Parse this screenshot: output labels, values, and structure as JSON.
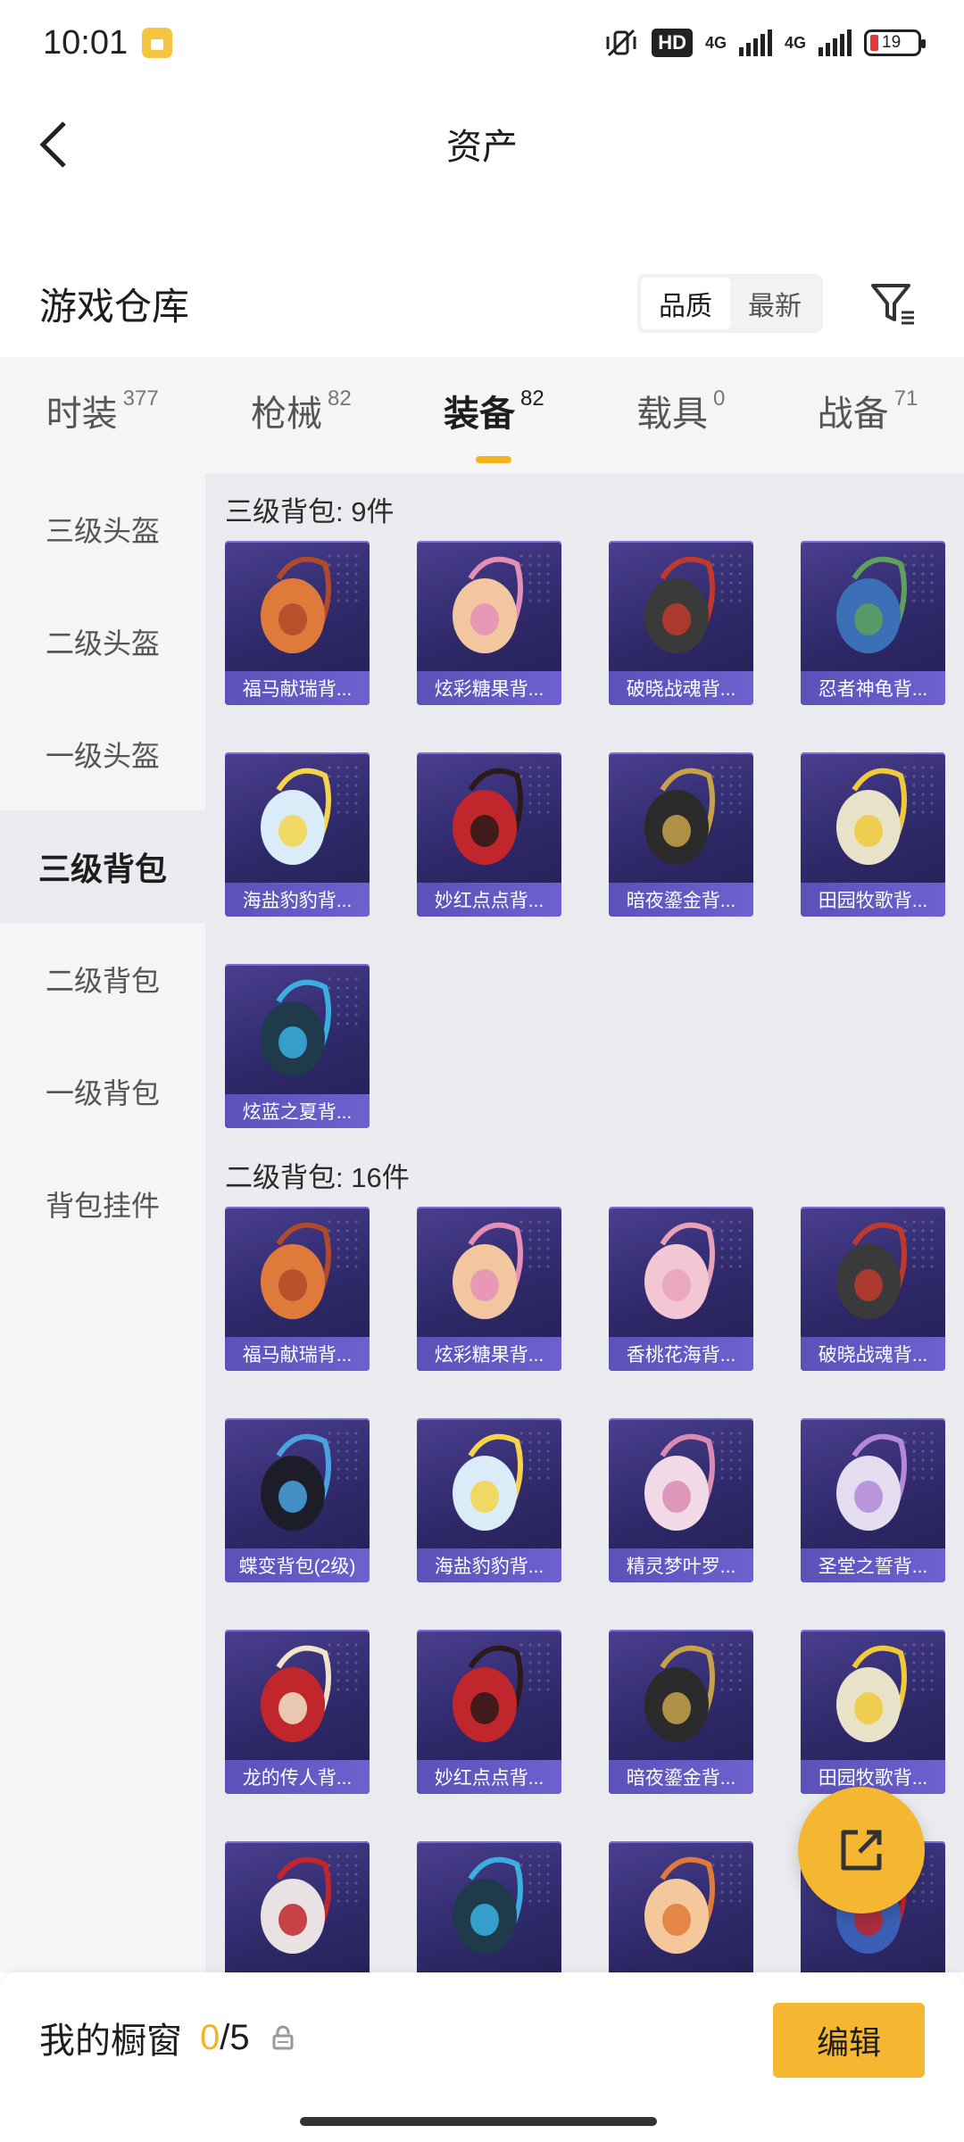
{
  "status_bar": {
    "time": "10:01",
    "hd": "HD",
    "net1": "4G",
    "net2": "4G",
    "battery": "19"
  },
  "header": {
    "title": "资产"
  },
  "warehouse": {
    "title": "游戏仓库",
    "sort_quality": "品质",
    "sort_newest": "最新"
  },
  "tabs": [
    {
      "label": "时装",
      "count": "377"
    },
    {
      "label": "枪械",
      "count": "82"
    },
    {
      "label": "装备",
      "count": "82"
    },
    {
      "label": "载具",
      "count": "0"
    },
    {
      "label": "战备",
      "count": "71"
    }
  ],
  "sidebar": {
    "items": [
      {
        "label": "三级头盔"
      },
      {
        "label": "二级头盔"
      },
      {
        "label": "一级头盔"
      },
      {
        "label": "三级背包"
      },
      {
        "label": "二级背包"
      },
      {
        "label": "一级背包"
      },
      {
        "label": "背包挂件"
      }
    ]
  },
  "sections": [
    {
      "title": "三级背包: 9件",
      "items": [
        {
          "name": "福马献瑞背...",
          "icon": "rabbit-backpack"
        },
        {
          "name": "炫彩糖果背...",
          "icon": "donut-backpack"
        },
        {
          "name": "破晓战魂背...",
          "icon": "armor-backpack"
        },
        {
          "name": "忍者神龟背...",
          "icon": "turtle-backpack"
        },
        {
          "name": "海盐豹豹背...",
          "icon": "seal-backpack"
        },
        {
          "name": "妙红点点背...",
          "icon": "ladybug-backpack"
        },
        {
          "name": "暗夜鎏金背...",
          "icon": "dark-gold-backpack"
        },
        {
          "name": "田园牧歌背...",
          "icon": "basket-backpack"
        },
        {
          "name": "炫蓝之夏背...",
          "icon": "blue-backpack"
        }
      ]
    },
    {
      "title": "二级背包: 16件",
      "items": [
        {
          "name": "福马献瑞背...",
          "icon": "rabbit-backpack"
        },
        {
          "name": "炫彩糖果背...",
          "icon": "donut-backpack"
        },
        {
          "name": "香桃花海背...",
          "icon": "pink-backpack"
        },
        {
          "name": "破晓战魂背...",
          "icon": "armor-backpack"
        },
        {
          "name": "蝶变背包(2级)",
          "icon": "butterfly-backpack"
        },
        {
          "name": "海盐豹豹背...",
          "icon": "seal-backpack"
        },
        {
          "name": "精灵梦叶罗...",
          "icon": "heart-backpack"
        },
        {
          "name": "圣堂之誓背...",
          "icon": "wing-backpack"
        },
        {
          "name": "龙的传人背...",
          "icon": "red-backpack"
        },
        {
          "name": "妙红点点背...",
          "icon": "ladybug-backpack"
        },
        {
          "name": "暗夜鎏金背...",
          "icon": "dark-gold-backpack"
        },
        {
          "name": "田园牧歌背...",
          "icon": "basket-backpack"
        },
        {
          "name": "",
          "icon": "red-white-backpack"
        },
        {
          "name": "",
          "icon": "blue-backpack"
        },
        {
          "name": "",
          "icon": "orange-round-backpack"
        },
        {
          "name": "",
          "icon": "robot-backpack"
        }
      ]
    }
  ],
  "bottom": {
    "showcase_label": "我的橱窗",
    "showcase_count": "0",
    "showcase_sep": "/",
    "showcase_total": "5",
    "edit": "编辑"
  },
  "colors": {
    "accent": "#f5b731",
    "card_top": "#4a3f8f",
    "card_bottom": "#231f52",
    "card_label": "#6e61cf"
  }
}
